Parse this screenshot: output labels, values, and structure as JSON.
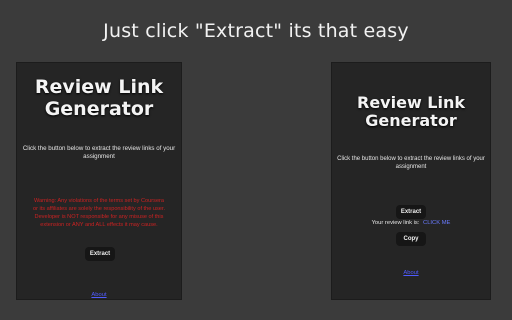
{
  "banner": {
    "text": "Just click \"Extract\" its that easy"
  },
  "left_panel": {
    "title_line1": "Review Link",
    "title_line2": "Generator",
    "description": "Click the button below to extract the review links of your assignment",
    "warning": "Warning: Any violations of the terms set by Coursera or its affiliates are solely the responsibility of the user. Developer is NOT responsible for any misuse of this extension or ANY and ALL effects it may cause.",
    "extract_label": "Extract",
    "footer_link": "About"
  },
  "right_panel": {
    "title_line1": "Review Link",
    "title_line2": "Generator",
    "description": "Click the button below to extract the review links of your assignment",
    "extract_label": "Extract",
    "review_text": "Your review link is:",
    "review_link": "CLICK ME",
    "copy_label": "Copy",
    "footer_link": "About"
  },
  "colors": {
    "background": "#3b3b3b",
    "panel": "#252525",
    "warning": "#cc2222",
    "link": "#4f5bff"
  }
}
